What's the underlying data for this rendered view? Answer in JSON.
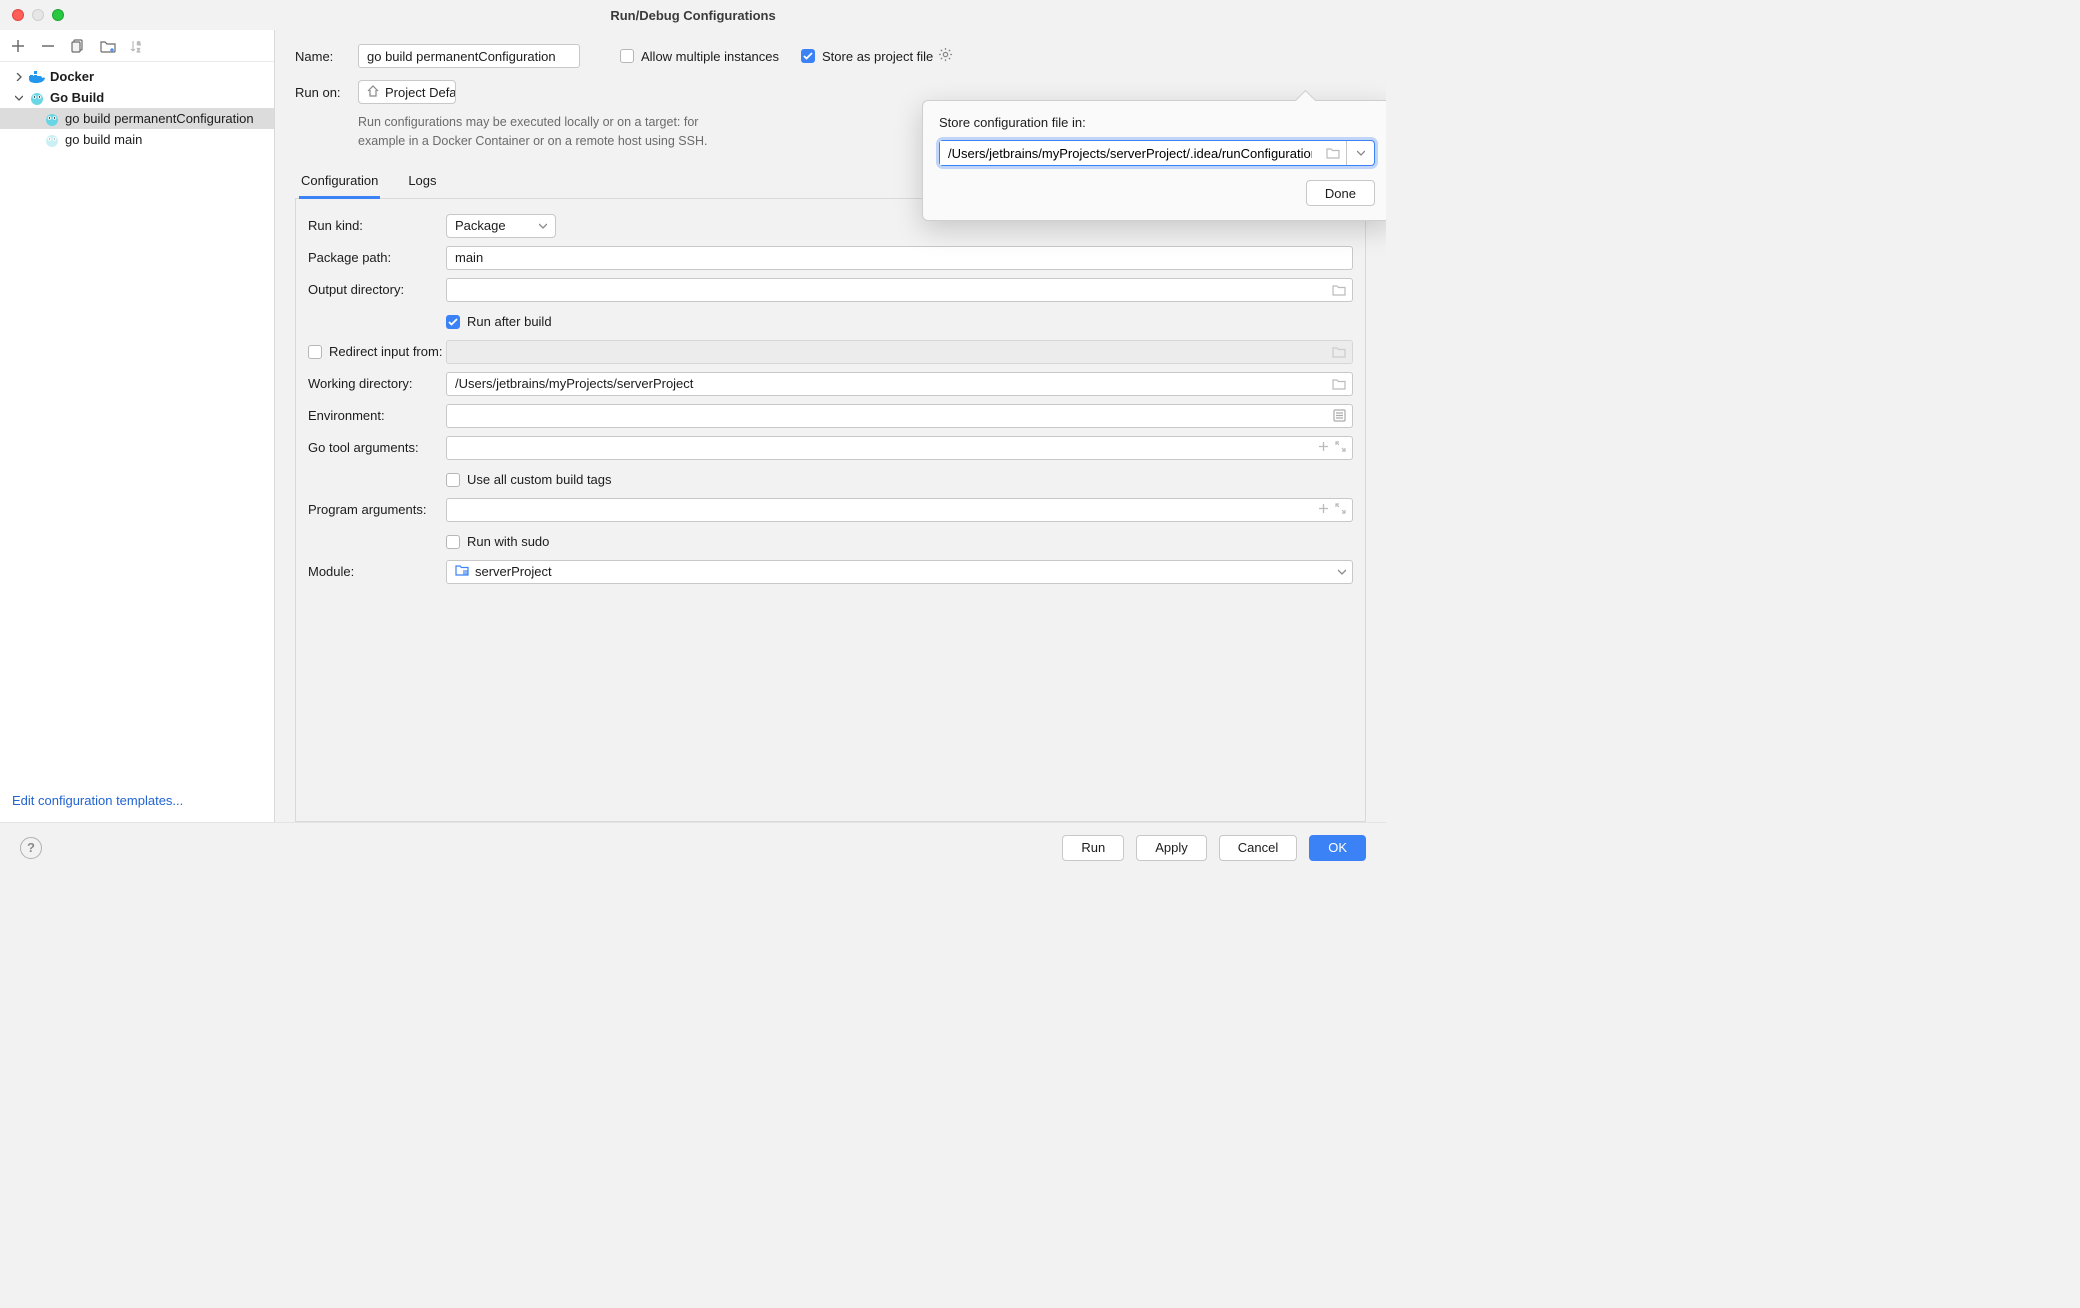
{
  "window": {
    "title": "Run/Debug Configurations"
  },
  "sidebar": {
    "nodes": {
      "docker": {
        "label": "Docker"
      },
      "gobuild": {
        "label": "Go Build"
      },
      "perm": {
        "label": "go build permanentConfiguration"
      },
      "main": {
        "label": "go build main"
      }
    },
    "footerLink": "Edit configuration templates..."
  },
  "form": {
    "name": {
      "label": "Name:",
      "value": "go build permanentConfiguration"
    },
    "allowMulti": {
      "label": "Allow multiple instances",
      "checked": false
    },
    "storeProject": {
      "label": "Store as project file",
      "checked": true
    },
    "runOn": {
      "label": "Run on:",
      "value": "Project Defa",
      "help": "Run configurations may be executed locally or on a target: for example in a Docker Container or on a remote host using SSH."
    },
    "tabs": {
      "config": "Configuration",
      "logs": "Logs"
    },
    "fields": {
      "runKind": {
        "label": "Run kind:",
        "value": "Package"
      },
      "packagePath": {
        "label": "Package path:",
        "value": "main"
      },
      "outputDir": {
        "label": "Output directory:",
        "value": ""
      },
      "runAfter": {
        "label": "Run after build",
        "checked": true
      },
      "redirect": {
        "label": "Redirect input from:",
        "checked": false,
        "value": ""
      },
      "workDir": {
        "label": "Working directory:",
        "value": "/Users/jetbrains/myProjects/serverProject"
      },
      "env": {
        "label": "Environment:",
        "value": ""
      },
      "goArgs": {
        "label": "Go tool arguments:",
        "value": ""
      },
      "useTags": {
        "label": "Use all custom build tags",
        "checked": false
      },
      "progArgs": {
        "label": "Program arguments:",
        "value": ""
      },
      "sudo": {
        "label": "Run with sudo",
        "checked": false
      },
      "module": {
        "label": "Module:",
        "value": "serverProject"
      }
    }
  },
  "popover": {
    "title": "Store configuration file in:",
    "path": "/Users/jetbrains/myProjects/serverProject/.idea/runConfigurations",
    "done": "Done"
  },
  "buttons": {
    "run": "Run",
    "apply": "Apply",
    "cancel": "Cancel",
    "ok": "OK"
  }
}
